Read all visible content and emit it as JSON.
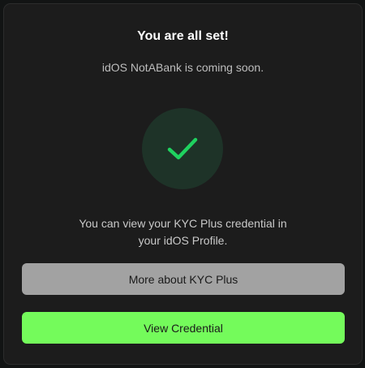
{
  "dialog": {
    "title": "You are all set!",
    "subtitle": "idOS NotABank is coming soon.",
    "status_icon": "check-icon",
    "message_line1": "You can view your KYC Plus credential in",
    "message_line2": "your idOS Profile.",
    "buttons": {
      "more_about": "More about KYC Plus",
      "view_credential": "View Credential"
    }
  },
  "colors": {
    "background": "#121414",
    "card": "#1c1c1c",
    "check_circle": "#1e3328",
    "check_mark": "#1fd25f",
    "secondary_button": "#a2a2a2",
    "primary_button": "#74fb5b"
  }
}
